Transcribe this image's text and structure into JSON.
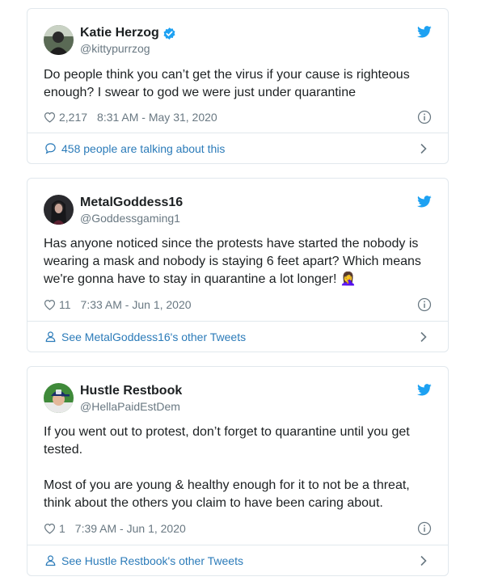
{
  "tweets": [
    {
      "author": {
        "name": "Katie Herzog",
        "handle": "@kittypurrzog",
        "verified": true
      },
      "text": "Do people think you can’t get the virus if your cause is righteous enough? I swear to god we were just under quarantine",
      "likes": "2,217",
      "timestamp": "8:31 AM - May 31, 2020",
      "footer": {
        "icon": "speech-bubble-icon",
        "label": "458 people are talking about this"
      }
    },
    {
      "author": {
        "name": "MetalGoddess16",
        "handle": "@Goddessgaming1",
        "verified": false
      },
      "text": "Has anyone noticed since the protests have started the nobody is wearing a mask and nobody is staying 6 feet apart? Which means we're gonna have to stay in quarantine a lot longer! 🤦‍♀️",
      "likes": "11",
      "timestamp": "7:33 AM - Jun 1, 2020",
      "footer": {
        "icon": "person-icon",
        "label": "See MetalGoddess16's other Tweets"
      }
    },
    {
      "author": {
        "name": "Hustle Restbook",
        "handle": "@HellaPaidEstDem",
        "verified": false
      },
      "text": "If you went out to protest, don’t forget to quarantine until you get tested.\n\nMost of you are young & healthy enough for it to not be a threat, think about the others you claim to have been caring about.",
      "likes": "1",
      "timestamp": "7:39 AM - Jun 1, 2020",
      "footer": {
        "icon": "person-icon",
        "label": "See Hustle Restbook's other Tweets"
      }
    }
  ],
  "colors": {
    "link": "#2b7bb9",
    "twitter_blue": "#1da1f2",
    "muted": "#697882",
    "border": "#e1e8ed"
  }
}
